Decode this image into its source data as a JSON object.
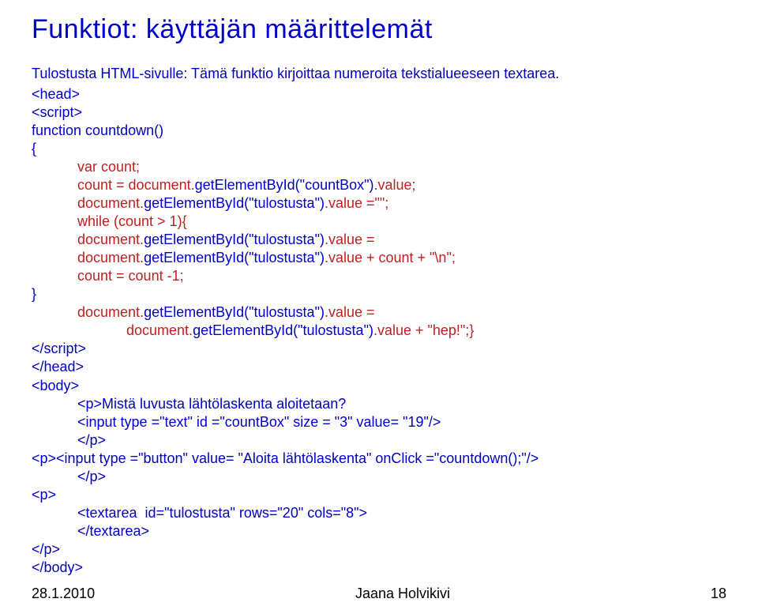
{
  "title": "Funktiot: käyttäjän määrittelemät",
  "intro": "Tulostusta HTML-sivulle: Tämä funktio kirjoittaa numeroita tekstialueeseen textarea.",
  "code": {
    "l1": "<head>",
    "l2": "<script>",
    "l3": "function countdown()",
    "l4": "{",
    "l5a": "var count;",
    "l6a": "count = document.",
    "l6b": "getElementById(\"countBox\")",
    "l6c": ".value;",
    "l7a": "document.",
    "l7b": "getElementById(\"tulostusta\")",
    "l7c": ".value =\"\";",
    "l8a": "while (count > 1){",
    "l9a": "document.",
    "l9b": "getElementById(\"tulostusta\")",
    "l9c": ".value =",
    "l10a": "document.",
    "l10b": "getElementById(\"tulostusta\")",
    "l10c": ".value + count + \"\\n\";",
    "l11a": "count = count -1;",
    "l12": "}",
    "l13a": "document.",
    "l13b": "getElementById(\"tulostusta\")",
    "l13c": ".value =",
    "l14a": "document.",
    "l14b": "getElementById(\"tulostusta\")",
    "l14c": ".value + \"hep!\";}",
    "l15": "</script>",
    "l16": "</head>",
    "l17": "<body>",
    "l18a": "<p>Mistä luvusta lähtölaskenta aloitetaan?",
    "l19a": "<input type =\"text\" id =\"countBox\" size = \"3\" value= \"19\"/>",
    "l20a": "</p>",
    "l21": "<p><input type =\"button\" value= \"Aloita lähtölaskenta\" onClick =\"countdown();\"/>",
    "l22a": "</p>",
    "l23": "<p>",
    "l24a": "<textarea  id=\"tulostusta\" rows=\"20\" cols=\"8\">",
    "l25a": "</textarea>",
    "l26": "</p>",
    "l27": "</body>"
  },
  "footer": {
    "date": "28.1.2010",
    "author": "Jaana Holvikivi",
    "page": "18"
  }
}
